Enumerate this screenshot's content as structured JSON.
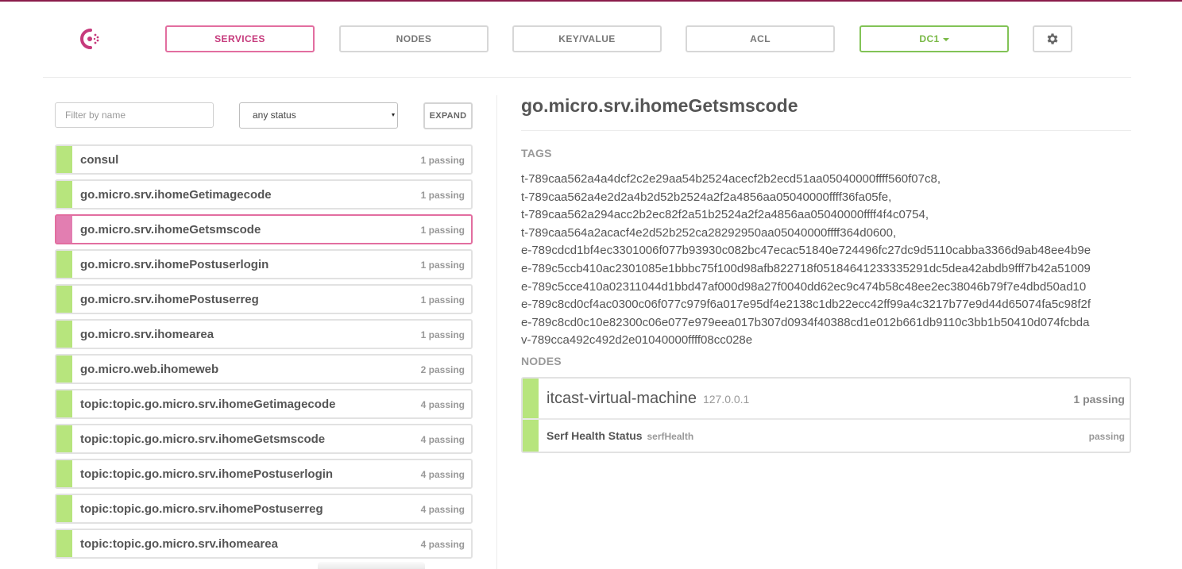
{
  "nav": {
    "items": [
      {
        "label": "SERVICES",
        "active": true
      },
      {
        "label": "NODES"
      },
      {
        "label": "KEY/VALUE"
      },
      {
        "label": "ACL"
      }
    ],
    "datacenter": "DC1",
    "settings_icon": "gear-icon",
    "logo_icon": "consul-logo-icon"
  },
  "filters": {
    "name_placeholder": "Filter by name",
    "status_selected": "any status",
    "expand_label": "EXPAND"
  },
  "services": [
    {
      "name": "consul",
      "status": "1 passing"
    },
    {
      "name": "go.micro.srv.ihomeGetimagecode",
      "status": "1 passing"
    },
    {
      "name": "go.micro.srv.ihomeGetsmscode",
      "status": "1 passing",
      "selected": true
    },
    {
      "name": "go.micro.srv.ihomePostuserlogin",
      "status": "1 passing"
    },
    {
      "name": "go.micro.srv.ihomePostuserreg",
      "status": "1 passing"
    },
    {
      "name": "go.micro.srv.ihomearea",
      "status": "1 passing"
    },
    {
      "name": "go.micro.web.ihomeweb",
      "status": "2 passing"
    },
    {
      "name": "topic:topic.go.micro.srv.ihomeGetimagecode",
      "status": "4 passing"
    },
    {
      "name": "topic:topic.go.micro.srv.ihomeGetsmscode",
      "status": "4 passing"
    },
    {
      "name": "topic:topic.go.micro.srv.ihomePostuserlogin",
      "status": "4 passing"
    },
    {
      "name": "topic:topic.go.micro.srv.ihomePostuserreg",
      "status": "4 passing"
    },
    {
      "name": "topic:topic.go.micro.srv.ihomearea",
      "status": "4 passing"
    }
  ],
  "detail": {
    "title": "go.micro.srv.ihomeGetsmscode",
    "tags_heading": "TAGS",
    "tags": [
      "t-789caa562a4a4dcf2c2e29aa54b2524acecf2b2ecd51aa05040000ffff560f07c8,",
      "t-789caa562a4e2d2a4b2d52b2524a2f2a4856aa05040000ffff36fa05fe,",
      "t-789caa562a294acc2b2ec82f2a51b2524a2f2a4856aa05040000ffff4f4c0754,",
      "t-789caa564a2acacf4e2d52b252ca28292950aa05040000ffff364d0600,",
      "e-789cdcd1bf4ec3301006f077b93930c082bc47ecac51840e724496fc27dc9d5110cabba3366d9ab48ee4b9e",
      "e-789c5ccb410ac2301085e1bbbc75f100d98afb822718f05184641233335291dc5dea42abdb9fff7b42a51009",
      "e-789c5cce410a02311044d1bbd47af000d98a27f0040dd62ec9c474b58c48ee2ec38046b79f7e4dbd50ad10",
      "e-789c8cd0cf4ac0300c06f077c979f6a017e95df4e2138c1db22ecc42ff99a4c3217b77e9d44d65074fa5c98f2f",
      "e-789c8cd0c10e82300c06e077e979eea017b307d0934f40388cd1e012b661db9110c3bb1b50410d074fcbda",
      "v-789cca492c492d2e01040000ffff08cc028e"
    ],
    "nodes_heading": "NODES",
    "node": {
      "name": "itcast-virtual-machine",
      "address": "127.0.0.1",
      "status": "1 passing",
      "check": {
        "name": "Serf Health Status",
        "id": "serfHealth",
        "status": "passing"
      }
    }
  },
  "colors": {
    "brand": "#8a1c4a",
    "active_pink": "#e26ea0",
    "passing_green": "#b7e57d",
    "dc_green": "#82c356"
  }
}
